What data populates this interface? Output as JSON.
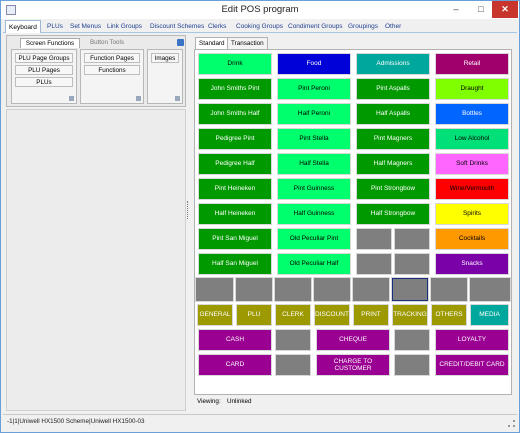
{
  "window": {
    "title": "Edit POS program"
  },
  "window_controls": {
    "minimize": "‒",
    "maximize": "□",
    "close": "✕"
  },
  "menu": {
    "items": [
      "Keyboard",
      "PLUs",
      "Set Menus",
      "Link Groups",
      "Discount Schemes",
      "Clerks",
      "Cooking Groups",
      "Condiment Groups",
      "Groupings",
      "Other"
    ],
    "active": "Keyboard"
  },
  "left_panel": {
    "tabs": [
      "Screen Functions",
      "Button Tools"
    ],
    "group1": [
      "PLU Page Groups",
      "PLU Pages",
      "PLUs"
    ],
    "group2": [
      "Function Pages",
      "Functions"
    ],
    "group3": [
      "Images"
    ]
  },
  "right_panel": {
    "tabs": [
      "Standard",
      "Transaction"
    ]
  },
  "keys": {
    "row0": [
      "Drink",
      "Food",
      "Admissions",
      "Retail"
    ],
    "row1": [
      "John Smiths Pint",
      "Pint Peroni",
      "Pint Aspalls",
      "Draught"
    ],
    "row2": [
      "John Smiths Half",
      "Half Peroni",
      "Half Aspalls",
      "Bottles"
    ],
    "row3": [
      "Pedigree Pint",
      "Pint Stella",
      "Pint Magners",
      "Low Alcohol"
    ],
    "row4": [
      "Pedigree Half",
      "Half Stella",
      "Half Magners",
      "Soft Drinks"
    ],
    "row5": [
      "Pint Heineken",
      "Pint Guinness",
      "Pint Strongbow",
      "Wine/Vermouth"
    ],
    "row6": [
      "Half Heineken",
      "Half Guinness",
      "Half Strongbow",
      "Spirits"
    ],
    "row7": [
      "Pint San Miguel",
      "Old Peculiar Pint",
      "Cocktails"
    ],
    "row8": [
      "Half San Miguel",
      "Old Peculiar Half",
      "Snacks"
    ],
    "func": [
      "GENERAL",
      "PLU",
      "CLERK",
      "DISCOUNT",
      "PRINT",
      "TRACKING",
      "OTHERS",
      "MEDIA"
    ],
    "pay1": [
      "CASH",
      "CHEQUE",
      "LOYALTY"
    ],
    "pay2": [
      "CARD",
      "CHARGE TO CUSTOMER",
      "CREDIT/DEBIT CARD"
    ]
  },
  "viewing": {
    "label": "Viewing:",
    "value": "Unlinked"
  },
  "status": {
    "text": "-1|1|Uniwell HX1500 Scheme|Uniwell HX1500-03"
  },
  "colors": {
    "green": "#009a00",
    "lime": "#00ff6c",
    "blue": "#0000d8",
    "teal": "#00a79c",
    "maroon": "#a0006c",
    "draught": "#80ff00",
    "bottles": "#0066ff",
    "low_alcohol": "#00e078",
    "soft_drinks": "#ff66ff",
    "wine": "#ff0000",
    "spirits": "#ffff00",
    "cocktails": "#ff9900",
    "snacks": "#7a00a8",
    "purple": "#9a0091",
    "olive": "#9c9a00",
    "gray": "#7f7f7f"
  }
}
